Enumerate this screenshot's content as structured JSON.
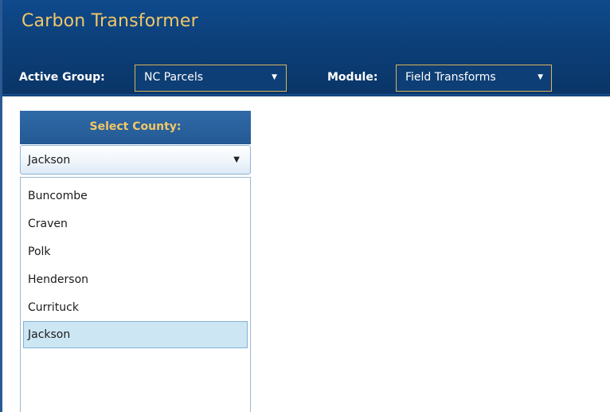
{
  "app": {
    "title": "Carbon Transformer"
  },
  "toolbar": {
    "active_group_label": "Active Group:",
    "active_group_value": "NC Parcels",
    "module_label": "Module:",
    "module_value": "Field Transforms"
  },
  "panel": {
    "header": "Select County:",
    "county_select_value": "Jackson",
    "options": [
      "Buncombe",
      "Craven",
      "Polk",
      "Henderson",
      "Currituck",
      "Jackson"
    ],
    "selected_option": "Jackson"
  },
  "colors": {
    "header_bg": "#0c3f78",
    "accent_gold": "#f2c766",
    "panel_header_bg": "#2a6099",
    "selected_item_bg": "#cde6f4"
  },
  "icons": {
    "dropdown": "triangle-down-icon"
  }
}
